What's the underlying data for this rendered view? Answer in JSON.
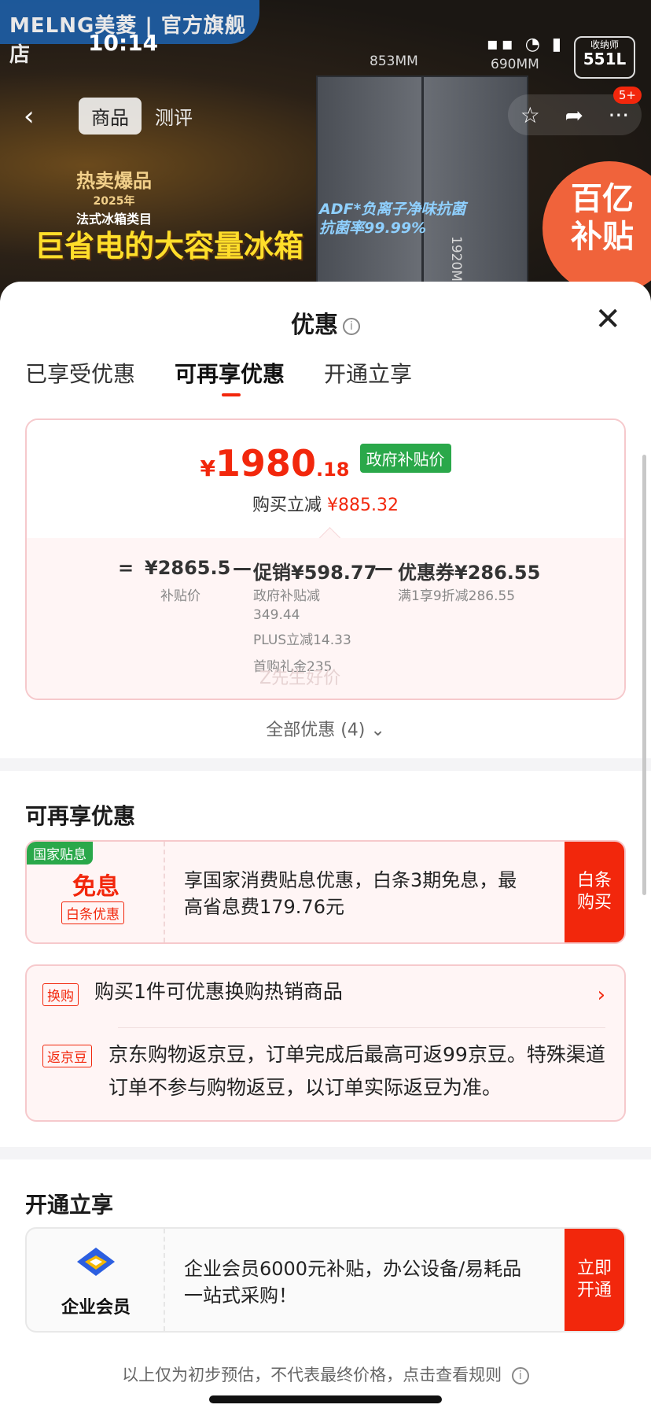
{
  "status_bar": {
    "time": "10:14",
    "icons": "▪▪ ◔ ▮"
  },
  "brand": {
    "name": "MELNG美菱 | 官方旗舰店"
  },
  "product_bg": {
    "width_label": "853MM",
    "depth_label": "690MM",
    "height_label": "1920MM",
    "volume_label": "收纳师",
    "volume_value": "551L",
    "hot_label": "热卖爆品",
    "hot_year": "2025年",
    "hot_category": "法式冰箱类目",
    "slogan": "巨省电的大容量冰箱",
    "adf_line1": "ADF*负离子净味抗菌",
    "adf_line2": "抗菌率99.99%",
    "subsidy_line1": "百亿",
    "subsidy_line2": "补贴"
  },
  "nav": {
    "back_icon": "chevron-left",
    "tab_product": "商品",
    "tab_review": "测评",
    "star_icon": "☆",
    "share_icon": "➦",
    "more_icon": "···",
    "more_badge": "5+"
  },
  "sheet": {
    "title": "优惠",
    "info_icon": "i",
    "close_icon": "✕",
    "tabs": [
      "已享受优惠",
      "可再享优惠",
      "开通立享"
    ],
    "active_tab": 1
  },
  "price": {
    "currency": "¥",
    "integer": "1980",
    "decimal": ".18",
    "tag": "政府补贴价",
    "discount_label": "购买立减",
    "discount_value": "¥885.32",
    "formula": {
      "eq": "=",
      "base_value": "¥2865.5",
      "base_label": "补贴价",
      "minus1": "—",
      "promo_value": "促销¥598.77",
      "promo_details": [
        "政府补贴减",
        "349.44",
        "PLUS立减14.33",
        "首购礼金235"
      ],
      "minus2": "—",
      "coupon_value": "优惠券¥286.55",
      "coupon_detail": "满1享9折减286.55"
    },
    "watermark": "Z先生好价"
  },
  "all_offers": "全部优惠 (4) ⌄",
  "section_more": {
    "title": "可再享优惠",
    "interest_card": {
      "gov_label": "国家贴息",
      "title": "免息",
      "tag": "白条优惠",
      "desc": "享国家消费贴息优惠，白条3期免息，最高省息费179.76元",
      "button": "白条购买"
    },
    "exchange": {
      "tag": "换购",
      "text": "购买1件可优惠换购热销商品",
      "chevron": "›"
    },
    "jingdou": {
      "tag": "返京豆",
      "text": "京东购物返京豆，订单完成后最高可返99京豆。特殊渠道订单不参与购物返豆，以订单实际返豆为准。"
    }
  },
  "section_open": {
    "title": "开通立享",
    "enterprise": {
      "label": "企业会员",
      "desc": "企业会员6000元补贴，办公设备/易耗品一站式采购！",
      "button": "立即开通"
    }
  },
  "footer_note": "以上仅为初步预估，不代表最终价格，点击查看规则",
  "colors": {
    "accent": "#f2270c",
    "gov_green": "#2aa84a",
    "card_bg": "#fff5f5",
    "card_border": "#f6c9cc"
  }
}
